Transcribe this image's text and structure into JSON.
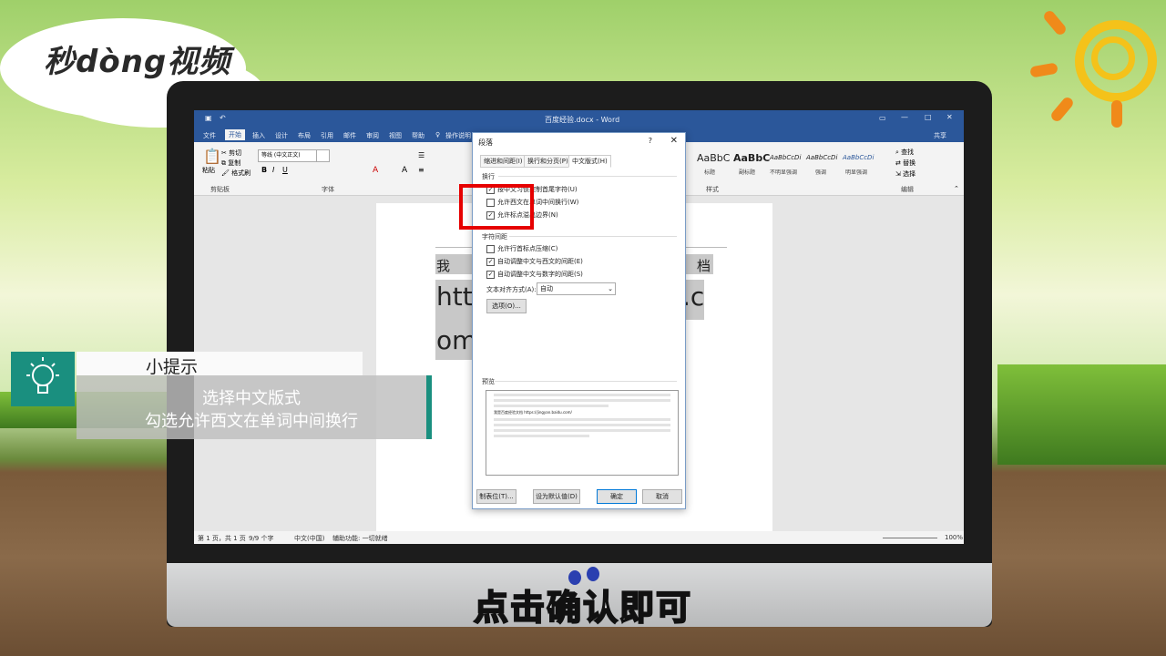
{
  "logo": {
    "text": "秒dòng视频"
  },
  "word": {
    "title": "百度经验.docx - Word",
    "tabs": [
      "文件",
      "开始",
      "插入",
      "设计",
      "布局",
      "引用",
      "邮件",
      "审阅",
      "视图",
      "帮助",
      "操作说明"
    ],
    "share": "共享",
    "clipboard": {
      "paste": "粘贴",
      "cut": "剪切",
      "copy": "复制",
      "format_painter": "格式刷",
      "group": "剪贴板"
    },
    "font": {
      "name": "等线 (中文正文)",
      "group": "字体"
    },
    "styles": {
      "group": "样式",
      "items": [
        {
          "sample": "AaBbC",
          "label": "标题"
        },
        {
          "sample": "AaBbC",
          "label": "副标题"
        },
        {
          "sample": "AaBbCcDi",
          "label": "不明显强调"
        },
        {
          "sample": "AaBbCcDi",
          "label": "强调"
        },
        {
          "sample": "AaBbCcDi",
          "label": "明显强调"
        }
      ]
    },
    "editing": {
      "find": "查找",
      "replace": "替换",
      "select": "选择",
      "group": "编辑"
    },
    "doc": {
      "line1a": "我",
      "line1b": "档",
      "line2a": "http",
      "line2b": ".c",
      "line3": "om"
    },
    "status": {
      "page": "第 1 页，共 1 页",
      "words": "9/9 个字",
      "lang": "中文(中国)",
      "access": "辅助功能: 一切就绪",
      "zoom": "100%"
    }
  },
  "dialog": {
    "title": "段落",
    "help": "?",
    "close": "✕",
    "tabs": [
      "缩进和间距(I)",
      "换行和分页(P)",
      "中文版式(H)"
    ],
    "section_wrap": "换行",
    "wrap_items": [
      {
        "label": "按中文习惯控制首尾字符(U)",
        "checked": true
      },
      {
        "label": "允许西文在单词中间换行(W)",
        "checked": false
      },
      {
        "label": "允许标点溢出边界(N)",
        "checked": true
      }
    ],
    "section_spacing": "字符间距",
    "spacing_items": [
      {
        "label": "允许行首标点压缩(C)",
        "checked": false
      },
      {
        "label": "自动调整中文与西文的间距(E)",
        "checked": true
      },
      {
        "label": "自动调整中文与数字的间距(S)",
        "checked": true
      }
    ],
    "align_label": "文本对齐方式(A):",
    "align_value": "自动",
    "options_button": "选项(O)...",
    "preview_label": "预览",
    "preview_sample": "我是百度经验文档 https://jingyan.baidu.com/",
    "buttons": {
      "tabs": "制表位(T)...",
      "default": "设为默认值(D)",
      "ok": "确定",
      "cancel": "取消"
    }
  },
  "tip": {
    "header": "小提示",
    "line1": "选择中文版式",
    "line2": "勾选允许西文在单词中间换行"
  },
  "subtitle": "点击确认即可"
}
